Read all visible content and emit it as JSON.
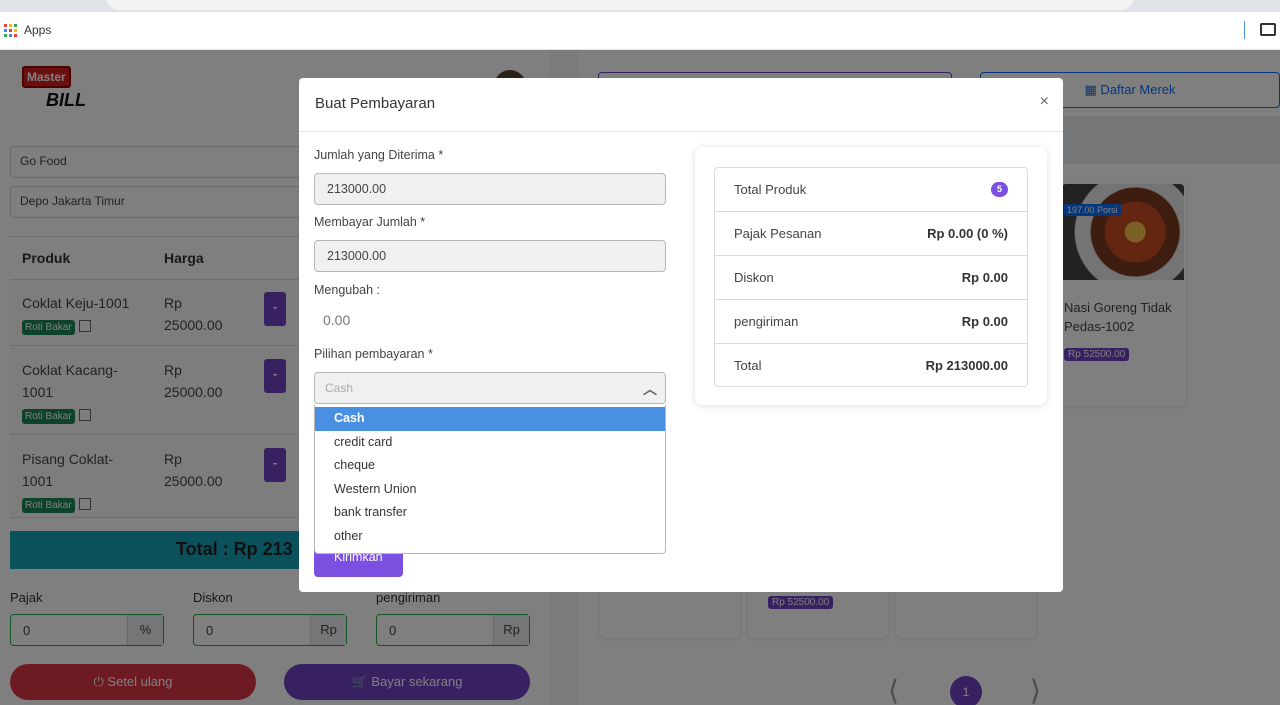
{
  "browser": {
    "bookmarks_label": "Apps"
  },
  "background_app": {
    "logo_line1": "Master",
    "logo_line2": "BILL",
    "selects": [
      "Go Food",
      "Depo Jakarta Timur"
    ],
    "table_headers": [
      "Produk",
      "Harga"
    ],
    "cart_rows": [
      {
        "name": "Coklat Keju-1001",
        "price_line1": "Rp",
        "price_line2": "25000.00",
        "category": "Roti Bakar",
        "minus": "-"
      },
      {
        "name": "Coklat Kacang-1001",
        "price_line1": "Rp",
        "price_line2": "25000.00",
        "category": "Roti Bakar",
        "minus": "-"
      },
      {
        "name": "Pisang Coklat-1001",
        "price_line1": "Rp",
        "price_line2": "25000.00",
        "category": "Roti Bakar",
        "minus": "-"
      }
    ],
    "total_label": "Total : Rp 213",
    "fields": [
      {
        "label": "Pajak",
        "value": "0",
        "unit": "%"
      },
      {
        "label": "Diskon",
        "value": "0",
        "unit": "Rp"
      },
      {
        "label": "pengiriman",
        "value": "0",
        "unit": "Rp"
      }
    ],
    "reset_button": "Setel ulang",
    "pay_button": "Bayar sekarang",
    "brand_list_button": "Daftar Merek",
    "products": [
      {
        "porsi": "197.00 Porsi",
        "name": "Nasi Goreng Tidak Pedas-1002",
        "price": "Rp 52500.00"
      },
      {
        "price": "Rp 52500.00"
      }
    ],
    "page_number": "1"
  },
  "modal": {
    "title": "Buat Pembayaran",
    "close": "×",
    "received_label": "Jumlah yang Diterima *",
    "received_value": "213000.00",
    "pay_amount_label": "Membayar Jumlah *",
    "pay_amount_value": "213000.00",
    "change_label": "Mengubah :",
    "change_value": "0.00",
    "payment_option_label": "Pilihan pembayaran *",
    "payment_placeholder": "Cash",
    "payment_options": [
      "Cash",
      "credit card",
      "cheque",
      "Western Union",
      "bank transfer",
      "other"
    ],
    "selected_option": "Cash",
    "submit_button": "Kirimkan",
    "summary": {
      "total_products_label": "Total Produk",
      "total_products_count": "5",
      "tax_label": "Pajak Pesanan",
      "tax_value": "Rp 0.00 (0 %)",
      "discount_label": "Diskon",
      "discount_value": "Rp 0.00",
      "shipping_label": "pengiriman",
      "shipping_value": "Rp 0.00",
      "total_label": "Total",
      "total_value": "Rp 213000.00"
    }
  },
  "colors": {
    "accent": "#6f42c1",
    "primary": "#0d6efd",
    "danger": "#dc3545",
    "success": "#198754",
    "info": "#17a2b8",
    "dropdown_highlight": "#4a90e2"
  }
}
